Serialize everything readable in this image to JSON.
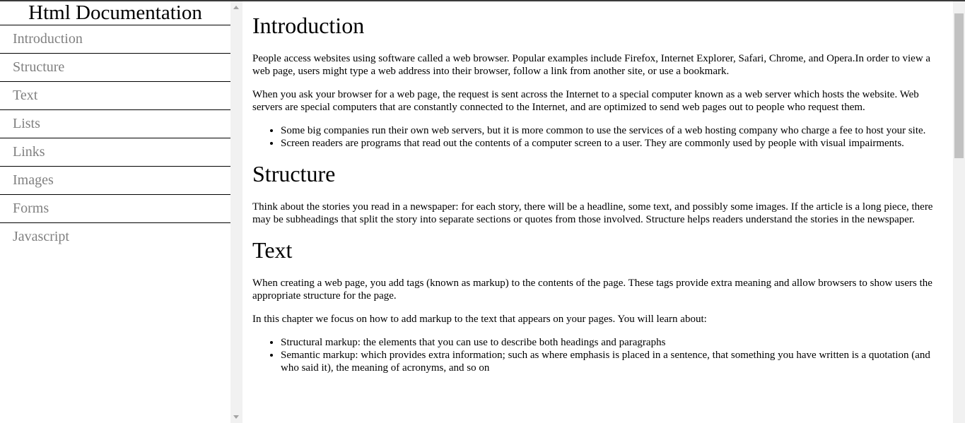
{
  "nav": {
    "title": "Html Documentation",
    "items": [
      {
        "label": "Introduction"
      },
      {
        "label": "Structure"
      },
      {
        "label": "Text"
      },
      {
        "label": "Lists"
      },
      {
        "label": "Links"
      },
      {
        "label": "Images"
      },
      {
        "label": "Forms"
      },
      {
        "label": "Javascript"
      }
    ]
  },
  "sections": {
    "introduction": {
      "title": "Introduction",
      "p1": "People access websites using software called a web browser. Popular examples include Firefox, Internet Explorer, Safari, Chrome, and Opera.In order to view a web page, users might type a web address into their browser, follow a link from another site, or use a bookmark.",
      "p2": "When you ask your browser for a web page, the request is sent across the Internet to a special computer known as a web server which hosts the website. Web servers are special computers that are constantly connected to the Internet, and are optimized to send web pages out to people who request them.",
      "bullets": [
        "Some big companies run their own web servers, but it is more common to use the services of a web hosting company who charge a fee to host your site.",
        "Screen readers are programs that read out the contents of a computer screen to a user. They are commonly used by people with visual impairments."
      ]
    },
    "structure": {
      "title": "Structure",
      "p1": "Think about the stories you read in a newspaper: for each story, there will be a headline, some text, and possibly some images. If the article is a long piece, there may be subheadings that split the story into separate sections or quotes from those involved. Structure helps readers understand the stories in the newspaper."
    },
    "text": {
      "title": "Text",
      "p1": "When creating a web page, you add tags (known as markup) to the contents of the page. These tags provide extra meaning and allow browsers to show users the appropriate structure for the page.",
      "p2": "In this chapter we focus on how to add markup to the text that appears on your pages. You will learn about:",
      "bullets": [
        "Structural markup: the elements that you can use to describe both headings and paragraphs",
        "Semantic markup: which provides extra information; such as where emphasis is placed in a sentence, that something you have written is a quotation (and who said it), the meaning of acronyms, and so on"
      ]
    }
  },
  "colors": {
    "nav_link": "#808080",
    "scroll_track": "#f1f1f1",
    "scroll_thumb": "#c1c1c1"
  }
}
